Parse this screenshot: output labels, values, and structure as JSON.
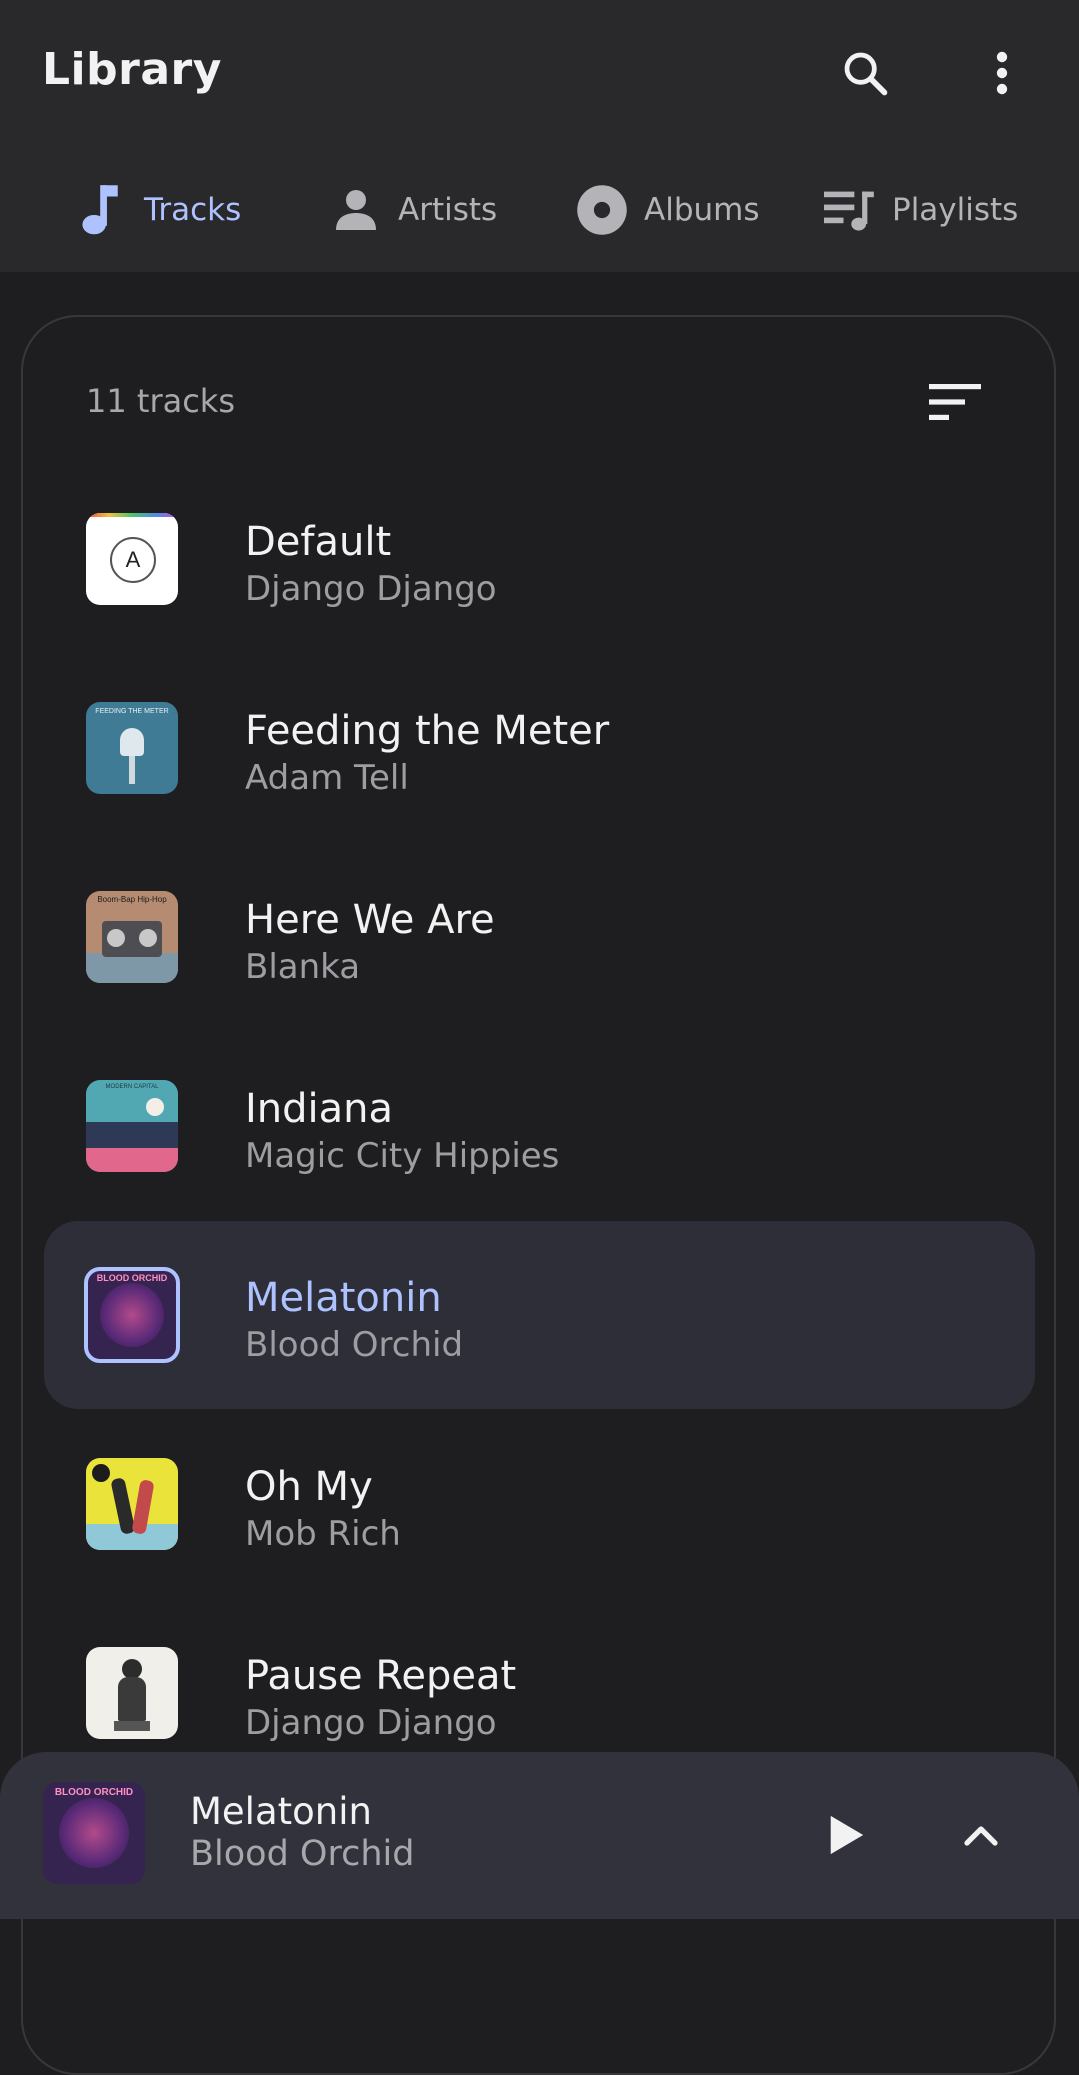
{
  "header": {
    "title": "Library",
    "search_icon": "search-icon",
    "more_icon": "more-vert-icon"
  },
  "tabs": [
    {
      "label": "Tracks",
      "icon": "music-note-icon",
      "active": true
    },
    {
      "label": "Artists",
      "icon": "person-icon",
      "active": false
    },
    {
      "label": "Albums",
      "icon": "album-icon",
      "active": false
    },
    {
      "label": "Playlists",
      "icon": "queue-music-icon",
      "active": false
    }
  ],
  "list": {
    "count_label": "11 tracks",
    "sort_icon": "sort-icon",
    "tracks": [
      {
        "title": "Default",
        "artist": "Django Django",
        "art_text": "A"
      },
      {
        "title": "Feeding the Meter",
        "artist": "Adam Tell",
        "art_text": "FEEDING THE METER"
      },
      {
        "title": "Here We Are",
        "artist": "Blanka",
        "art_text": "Boom-Bap Hip-Hop"
      },
      {
        "title": "Indiana",
        "artist": "Magic City Hippies",
        "art_text": "MODERN CAPITAL"
      },
      {
        "title": "Melatonin",
        "artist": "Blood Orchid",
        "art_text": "BLOOD ORCHID",
        "selected": true
      },
      {
        "title": "Oh My",
        "artist": "Mob Rich",
        "art_text": ""
      },
      {
        "title": "Pause Repeat",
        "artist": "Django Django",
        "art_text": ""
      }
    ]
  },
  "player": {
    "title": "Melatonin",
    "artist": "Blood Orchid",
    "art_text": "BLOOD ORCHID",
    "play_icon": "play-icon",
    "expand_icon": "chevron-up-icon"
  },
  "colors": {
    "accent": "#aec2ff",
    "background": "#1e1e20",
    "appbar": "#29292c",
    "selected_row": "#2d2e38",
    "player": "#31323c"
  }
}
